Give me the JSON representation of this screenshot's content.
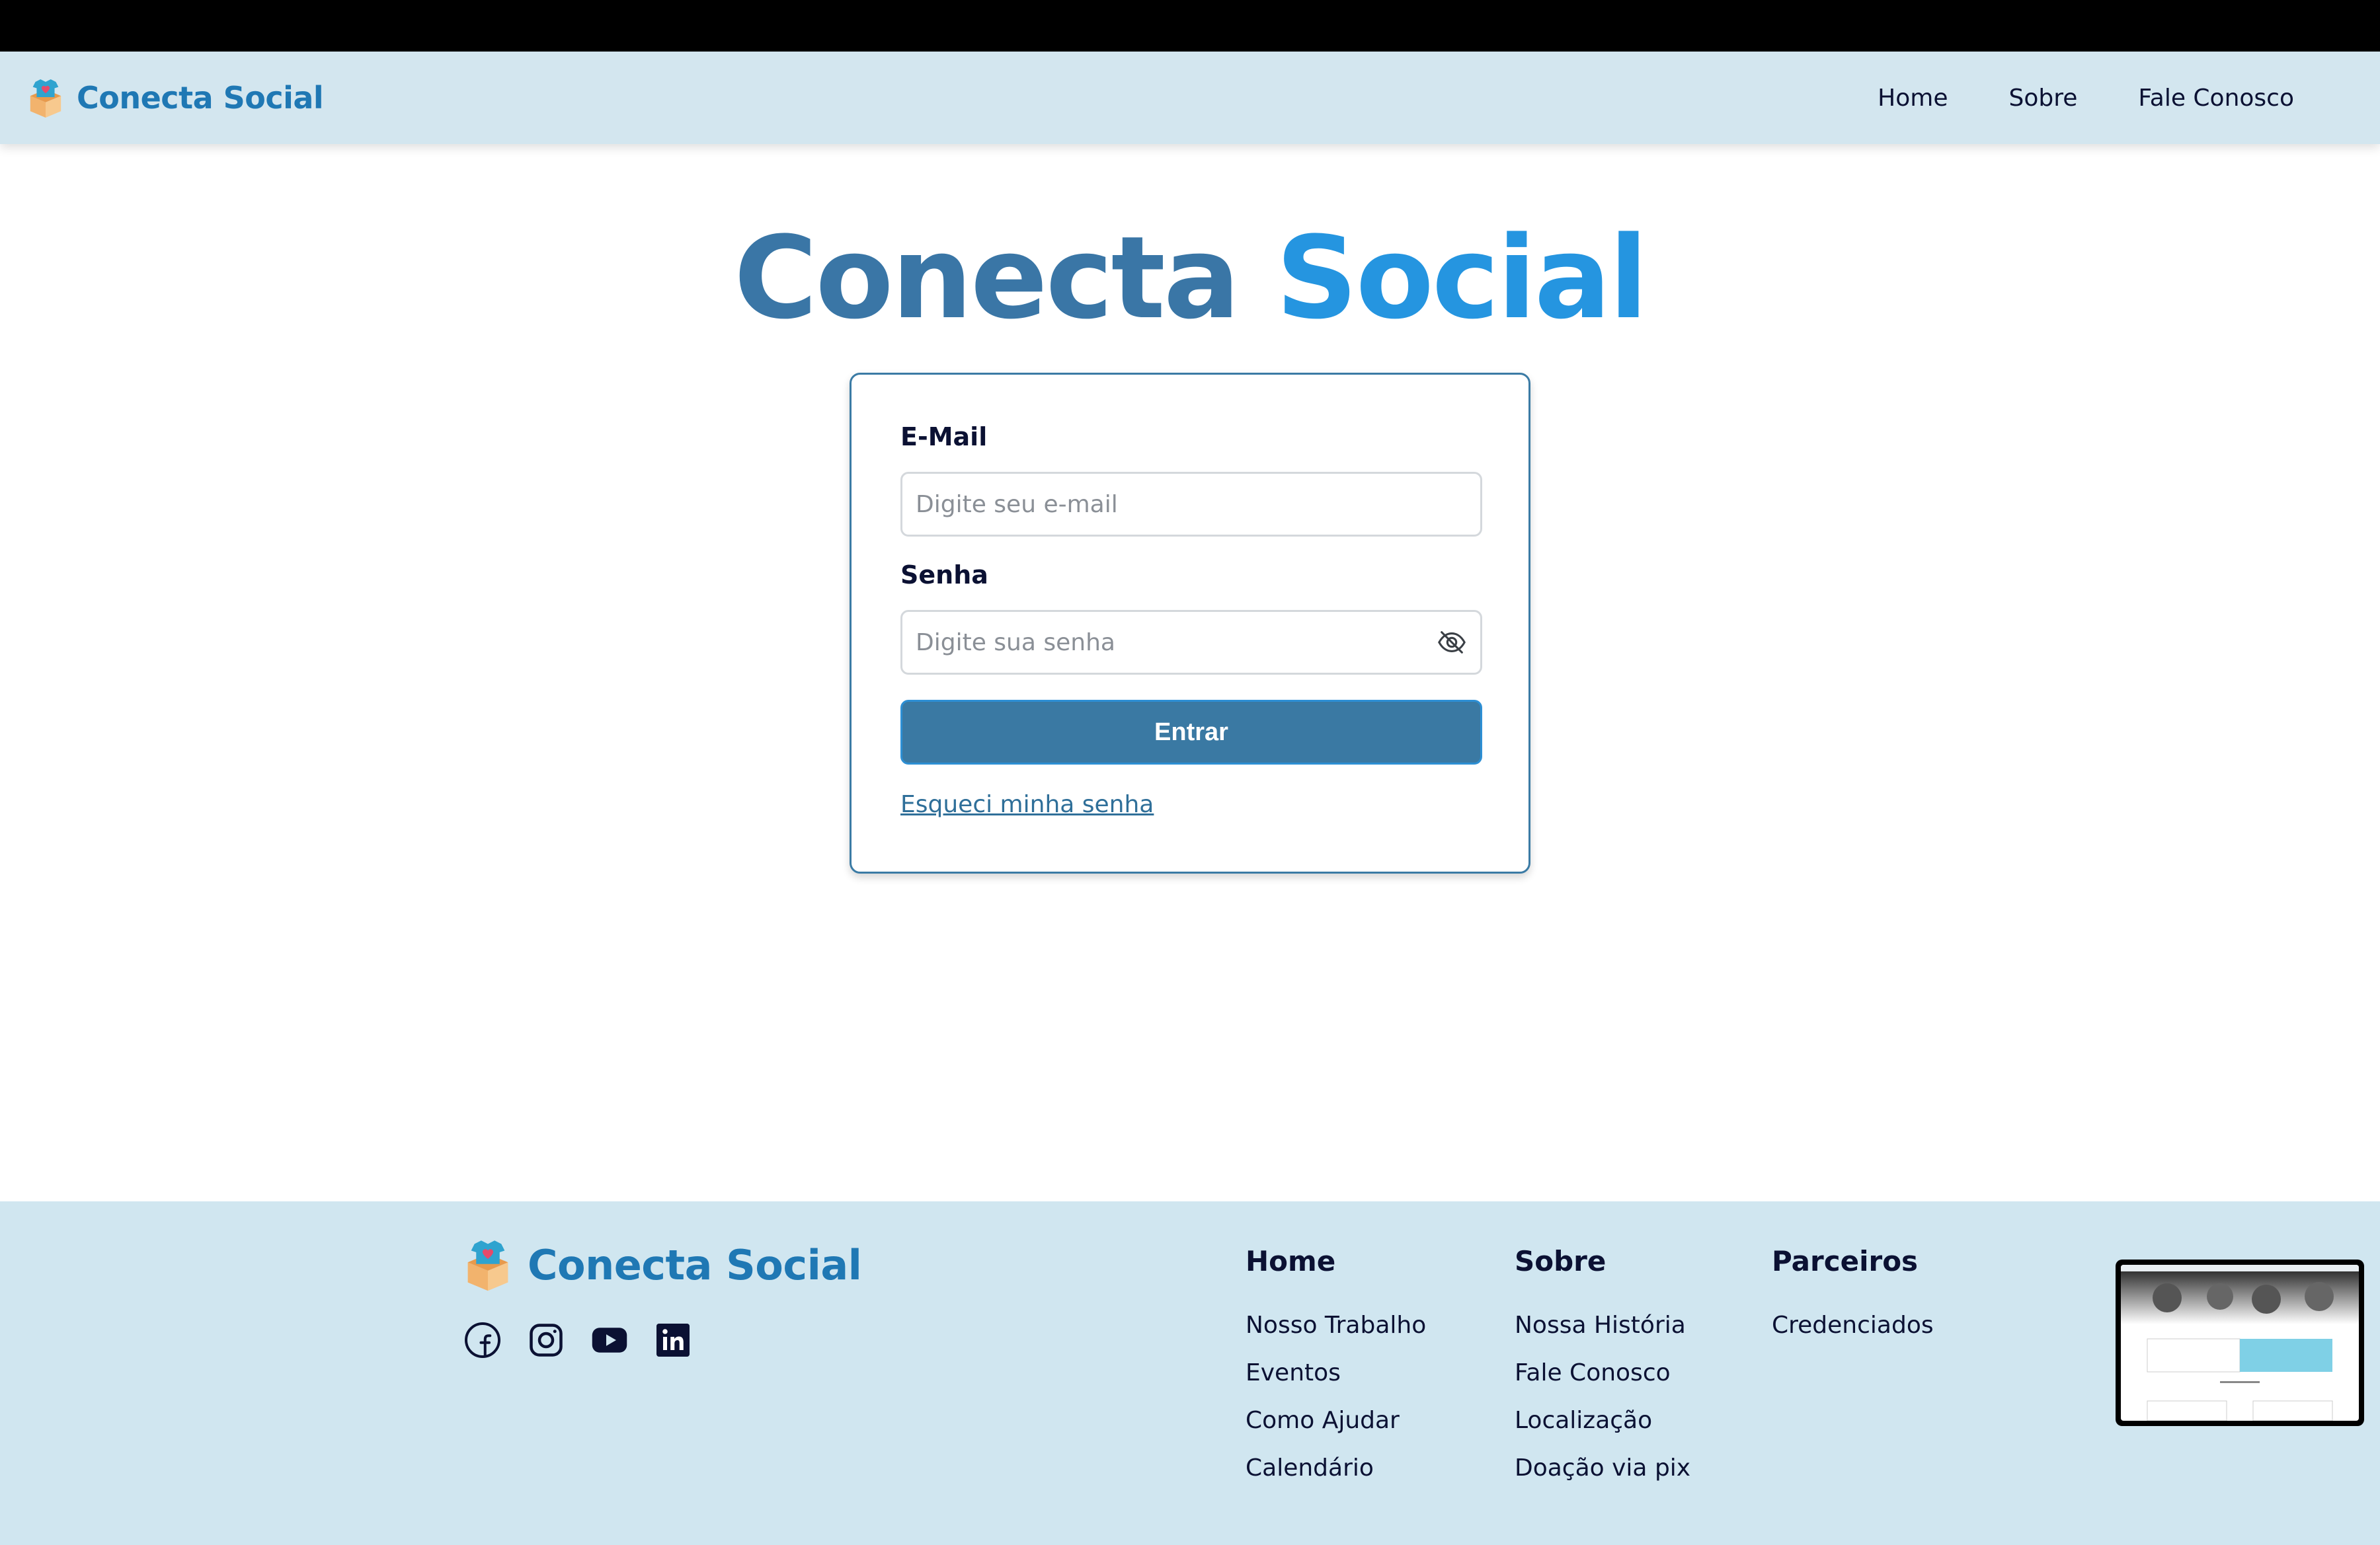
{
  "navbar": {
    "brand": "Conecta Social",
    "links": [
      "Home",
      "Sobre",
      "Fale Conosco"
    ]
  },
  "hero": {
    "title_part1": "Conecta",
    "title_part2": "Social"
  },
  "login": {
    "email_label": "E-Mail",
    "email_placeholder": "Digite seu e-mail",
    "password_label": "Senha",
    "password_placeholder": "Digite sua senha",
    "submit_label": "Entrar",
    "forgot_label": "Esqueci minha senha"
  },
  "footer": {
    "brand": "Conecta Social",
    "socials": [
      "facebook-icon",
      "instagram-icon",
      "youtube-icon",
      "linkedin-icon"
    ],
    "columns": [
      {
        "title": "Home",
        "links": [
          "Nosso Trabalho",
          "Eventos",
          "Como Ajudar",
          "Calendário"
        ]
      },
      {
        "title": "Sobre",
        "links": [
          "Nossa História",
          "Fale Conosco",
          "Localização",
          "Doação via pix"
        ]
      },
      {
        "title": "Parceiros",
        "links": [
          "Credenciados"
        ]
      }
    ]
  },
  "colors": {
    "nav_bg": "#d3e6ef",
    "footer_bg": "#d0e6f0",
    "brand": "#1f78b4",
    "button": "#3a79a3",
    "title_dark": "#3a76a6",
    "title_light": "#2595e0"
  }
}
